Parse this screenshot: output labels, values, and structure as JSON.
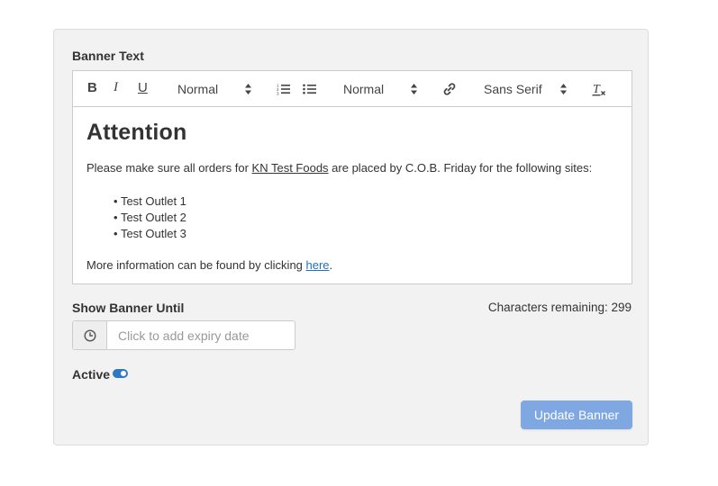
{
  "form": {
    "banner_text_label": "Banner Text",
    "show_until_label": "Show Banner Until",
    "characters_remaining": "Characters remaining: 299",
    "date_placeholder": "Click to add expiry date",
    "active_label": "Active",
    "active": true,
    "update_button": "Update Banner",
    "accent_color": "#2f78c4",
    "button_color": "#7fa8e2"
  },
  "toolbar": {
    "bold": "B",
    "italic": "I",
    "underline": "U",
    "heading_select": "Normal",
    "ordered_list_icon": "ordered-list-icon",
    "bullet_list_icon": "bullet-list-icon",
    "size_select": "Normal",
    "link_icon": "link-icon",
    "font_select": "Sans Serif",
    "clear_format_icon": "clear-formatting-icon"
  },
  "content": {
    "heading": "Attention",
    "para1_before": "Please make sure all orders for ",
    "para1_link": "KN Test Foods",
    "para1_after": " are placed by C.O.B. Friday for the following sites:",
    "bullets": [
      "Test Outlet 1",
      "Test Outlet 2",
      "Test Outlet 3"
    ],
    "para2_before": "More information can be found by clicking ",
    "para2_link": "here",
    "para2_after": "."
  }
}
